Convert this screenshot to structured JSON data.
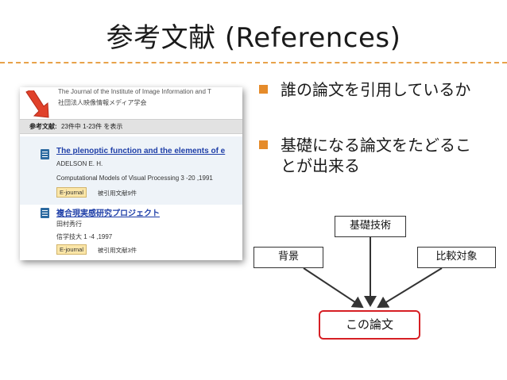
{
  "slide": {
    "title": "参考文献 (References)",
    "accent_color": "#e8a24a",
    "bullet_color": "#e58b2a"
  },
  "screenshot": {
    "journal_title": "The Journal of the Institute of Image Information and T",
    "society": "社団法人映像情報メディア学会",
    "ref_label": "参考文献:",
    "ref_count": "23件中 1-23件 を表示",
    "entries": [
      {
        "title": "The plenoptic function and the elements of e",
        "author": "ADELSON E. H.",
        "source": "Computational Models of Visual Processing   3 -20 ,1991",
        "badge": "E-journal",
        "cited": "被引用文献9件"
      },
      {
        "title": "複合現実感研究プロジェクト",
        "author": "田村秀行",
        "source": "信学技大   1 -4 ,1997",
        "badge": "E-journal",
        "cited": "被引用文献3件"
      }
    ],
    "arrow_icon": "red-down-right-arrow-icon"
  },
  "bullets": [
    "誰の論文を引用しているか",
    "基礎になる論文をたどることが出来る"
  ],
  "diagram": {
    "top_box": "基礎技術",
    "left_box": "背景",
    "right_box": "比較対象",
    "center_box": "この論文",
    "center_color": "#d61f24"
  }
}
